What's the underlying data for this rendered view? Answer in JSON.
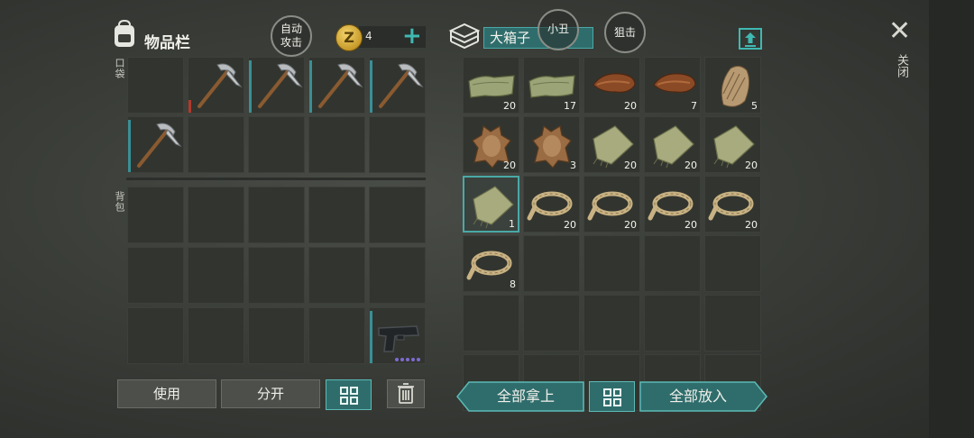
{
  "inventory": {
    "title": "物品栏",
    "auto_attack": "自动\n攻击",
    "coin_count": "4",
    "pocket_label": "口袋",
    "backpack_label": "背包",
    "pocket_slots": [
      {
        "item": ""
      },
      {
        "item": "pickaxe",
        "bar": "red"
      },
      {
        "item": "pickaxe",
        "bar": "teal"
      },
      {
        "item": "pickaxe",
        "bar": "teal"
      },
      {
        "item": "pickaxe",
        "bar": "teal"
      },
      {
        "item": "pickaxe",
        "bar": "teal"
      },
      {
        "item": ""
      },
      {
        "item": ""
      },
      {
        "item": ""
      },
      {
        "item": ""
      }
    ],
    "backpack_slots": [
      {
        "item": ""
      },
      {
        "item": ""
      },
      {
        "item": ""
      },
      {
        "item": ""
      },
      {
        "item": ""
      },
      {
        "item": ""
      },
      {
        "item": ""
      },
      {
        "item": ""
      },
      {
        "item": ""
      },
      {
        "item": ""
      },
      {
        "item": ""
      },
      {
        "item": ""
      },
      {
        "item": ""
      },
      {
        "item": ""
      },
      {
        "item": "pistol",
        "bar": "teal"
      }
    ],
    "buttons": {
      "use": "使用",
      "split": "分开"
    }
  },
  "box": {
    "name": "大箱子",
    "joker": "小丑",
    "snipe": "狙击",
    "take_all": "全部拿上",
    "put_all": "全部放入",
    "slots": [
      {
        "item": "cloth",
        "count": "20"
      },
      {
        "item": "cloth",
        "count": "17"
      },
      {
        "item": "leather",
        "count": "20"
      },
      {
        "item": "leather",
        "count": "7"
      },
      {
        "item": "fur",
        "count": "5"
      },
      {
        "item": "hide",
        "count": "20"
      },
      {
        "item": "hide",
        "count": "3"
      },
      {
        "item": "fabric",
        "count": "20"
      },
      {
        "item": "fabric",
        "count": "20"
      },
      {
        "item": "fabric",
        "count": "20"
      },
      {
        "item": "fabric",
        "count": "1",
        "selected": true
      },
      {
        "item": "rope",
        "count": "20"
      },
      {
        "item": "rope",
        "count": "20"
      },
      {
        "item": "rope",
        "count": "20"
      },
      {
        "item": "rope",
        "count": "20"
      },
      {
        "item": "rope",
        "count": "8"
      },
      {
        "item": ""
      },
      {
        "item": ""
      },
      {
        "item": ""
      },
      {
        "item": ""
      },
      {
        "item": ""
      },
      {
        "item": ""
      },
      {
        "item": ""
      },
      {
        "item": ""
      },
      {
        "item": ""
      },
      {
        "item": ""
      },
      {
        "item": ""
      },
      {
        "item": ""
      },
      {
        "item": ""
      },
      {
        "item": ""
      }
    ]
  },
  "close_label": "关闭",
  "icons": {
    "backpack": "backpack-icon",
    "coin": "coin-icon",
    "add": "plus-icon",
    "box": "box-icon",
    "upload": "upload-icon",
    "close": "close-icon",
    "grid": "grid-icon",
    "trash": "trash-icon"
  }
}
